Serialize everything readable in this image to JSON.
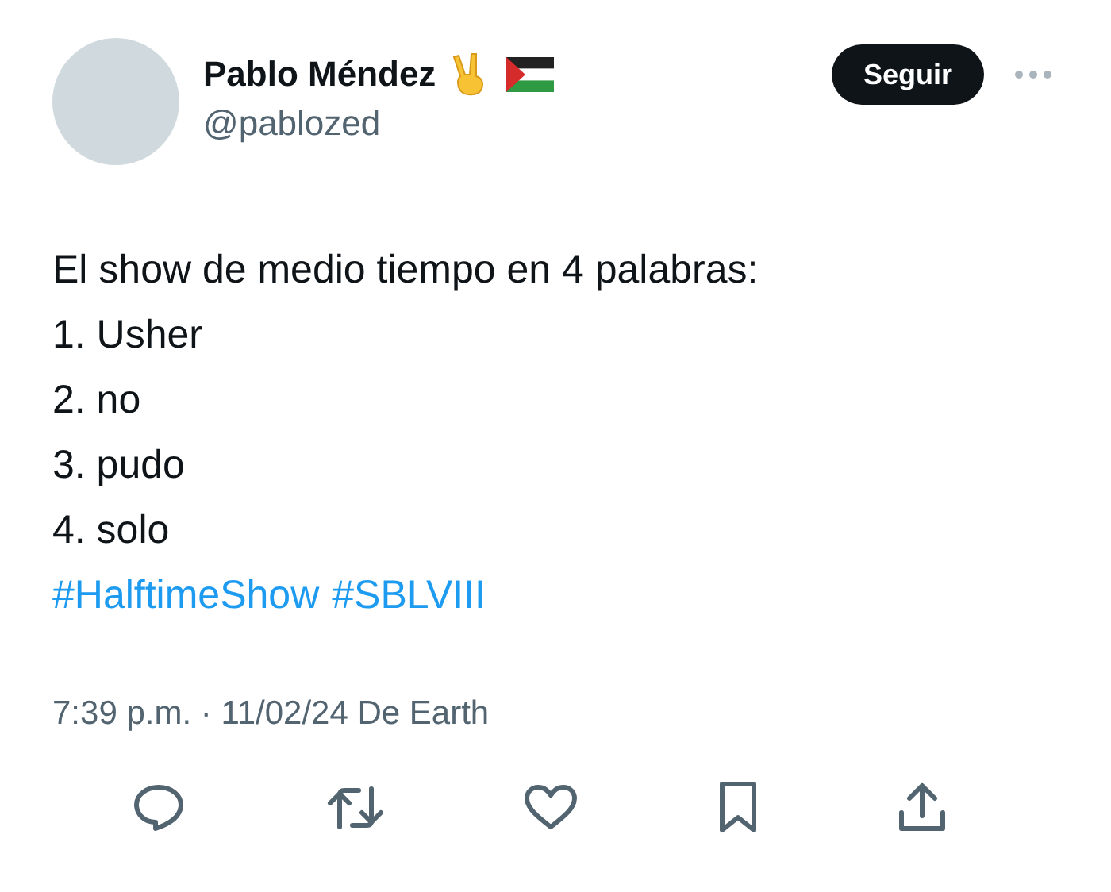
{
  "author": {
    "name": "Pablo Méndez",
    "handle": "@pablozed"
  },
  "follow_button": "Seguir",
  "lines": [
    "El show de medio tiempo en 4 palabras:",
    "1. Usher",
    "2. no",
    "3. pudo",
    "4. solo"
  ],
  "hashtags": [
    "#HalftimeShow",
    "#SBLVIII"
  ],
  "meta": "7:39 p.m. · 11/02/24 De Earth",
  "actions": [
    {
      "kind": "reply"
    },
    {
      "kind": "repost"
    },
    {
      "kind": "like"
    },
    {
      "kind": "bookmark"
    },
    {
      "kind": "share"
    }
  ]
}
